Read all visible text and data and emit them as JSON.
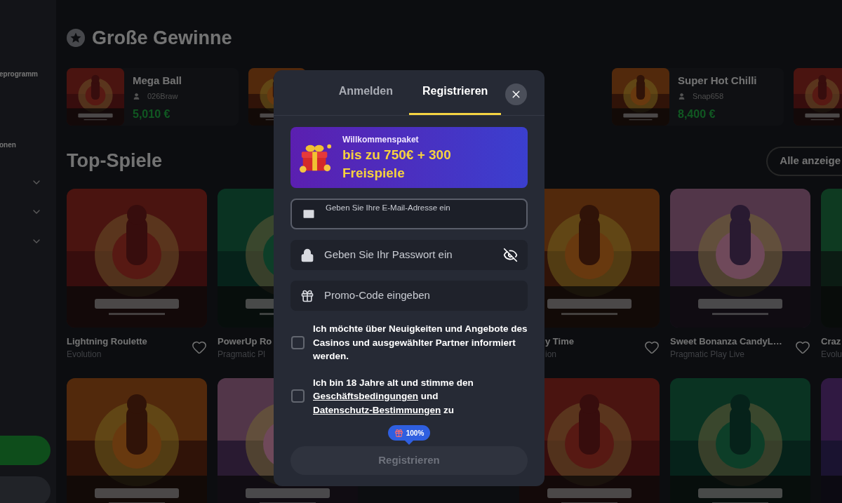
{
  "sidebar": {
    "items": [
      "eprogramm",
      "onen"
    ],
    "expanders": [
      {
        "expanded": false
      },
      {
        "expanded": false
      },
      {
        "expanded": false
      }
    ]
  },
  "big_wins": {
    "title": "Große Gewinne",
    "cards": [
      {
        "kind": "win",
        "game": "Mega Ball",
        "player": "026Braw",
        "amount": "5,010 €"
      },
      {
        "kind": "picture"
      },
      {
        "kind": "covered"
      },
      {
        "kind": "win",
        "game": "Super Hot Chilli",
        "player": "Snap658",
        "amount": "8,400 €"
      },
      {
        "kind": "picture"
      }
    ]
  },
  "top_games": {
    "title": "Top-Spiele",
    "show_all": "Alle anzeige",
    "rows": [
      [
        {
          "kind": "game",
          "title": "Lightning Roulette",
          "provider": "Evolution",
          "favorite": false
        },
        {
          "kind": "game",
          "title": "PowerUp Ro",
          "provider": "Pragmatic Pl"
        },
        {
          "kind": "covered"
        },
        {
          "kind": "game",
          "title": "y Time",
          "provider": "ion",
          "favorite": false
        },
        {
          "kind": "game",
          "title": "Sweet Bonanza CandyL…",
          "provider": "Pragmatic Play Live",
          "favorite": false
        },
        {
          "kind": "game",
          "title": "Craz",
          "provider": "Evolu"
        }
      ],
      [
        {
          "kind": "picture"
        },
        {
          "kind": "picture"
        },
        {
          "kind": "covered"
        },
        {
          "kind": "picture"
        },
        {
          "kind": "picture"
        },
        {
          "kind": "picture"
        }
      ]
    ]
  },
  "modal": {
    "tabs": [
      {
        "label": "Anmelden",
        "selected": false
      },
      {
        "label": "Registrieren",
        "selected": true
      }
    ],
    "banner": {
      "caption": "Willkommenspaket",
      "headline": "bis zu 750€ + 300 Freispiele"
    },
    "fields": [
      {
        "kind": "email",
        "placeholder": "Geben Sie Ihre E-Mail-Adresse ein",
        "focused": true
      },
      {
        "kind": "password",
        "placeholder": "Geben Sie Ihr Passwort ein",
        "focused": false
      },
      {
        "kind": "promo",
        "placeholder": "Promo-Code eingeben",
        "focused": false
      }
    ],
    "consents": [
      {
        "kind": "plain",
        "text": "Ich möchte über Neuigkeiten und Angebote des Casinos und ausgewählter Partner informiert werden.",
        "checked": false
      },
      {
        "kind": "terms",
        "before": "Ich bin 18 Jahre alt und stimme den",
        "link_terms": "Geschäftsbedingungen",
        "between": "und",
        "link_privacy": "Datenschutz-Bestimmungen",
        "after": "zu",
        "checked": false
      }
    ],
    "badge": "100%",
    "submit": {
      "label": "Registrieren",
      "disabled": true
    }
  }
}
